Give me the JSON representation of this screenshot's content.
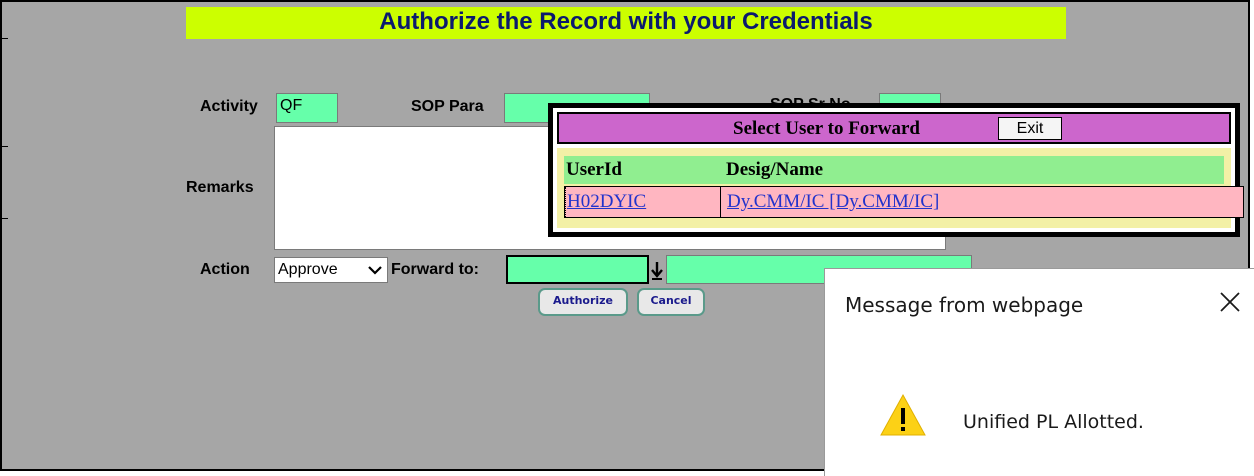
{
  "form": {
    "title": "Authorize the Record with your Credentials",
    "activity_label": "Activity",
    "activity_value": "QF",
    "sop_para_label": "SOP Para",
    "sop_sr_label": "SOP Sr No",
    "remarks_label": "Remarks",
    "action_label": "Action",
    "action_value": "Approve",
    "forward_label": "Forward to:",
    "authorize_button": "Authorize",
    "cancel_button": "Cancel"
  },
  "popup": {
    "title": "Select User to Forward",
    "exit_button": "Exit",
    "columns": [
      "UserId",
      "Desig/Name"
    ],
    "rows": [
      {
        "user_id": "H02DYIC",
        "desig_name": "Dy.CMM/IC [Dy.CMM/IC]"
      }
    ]
  },
  "dialog": {
    "title": "Message from webpage",
    "message": "Unified PL Allotted."
  },
  "colors": {
    "background": "#a6a6a6",
    "title_bar": "#ccff00",
    "field": "#66ffaa",
    "popup_header": "#cc66cc",
    "popup_table_header": "#90ee90",
    "popup_row": "#ffb6c1",
    "link": "#2233cc"
  },
  "icons": {
    "dropdown": "chevron-down-icon",
    "forward_select": "down-arrow-icon",
    "dialog_close": "close-icon",
    "dialog_warning": "warning-icon"
  }
}
